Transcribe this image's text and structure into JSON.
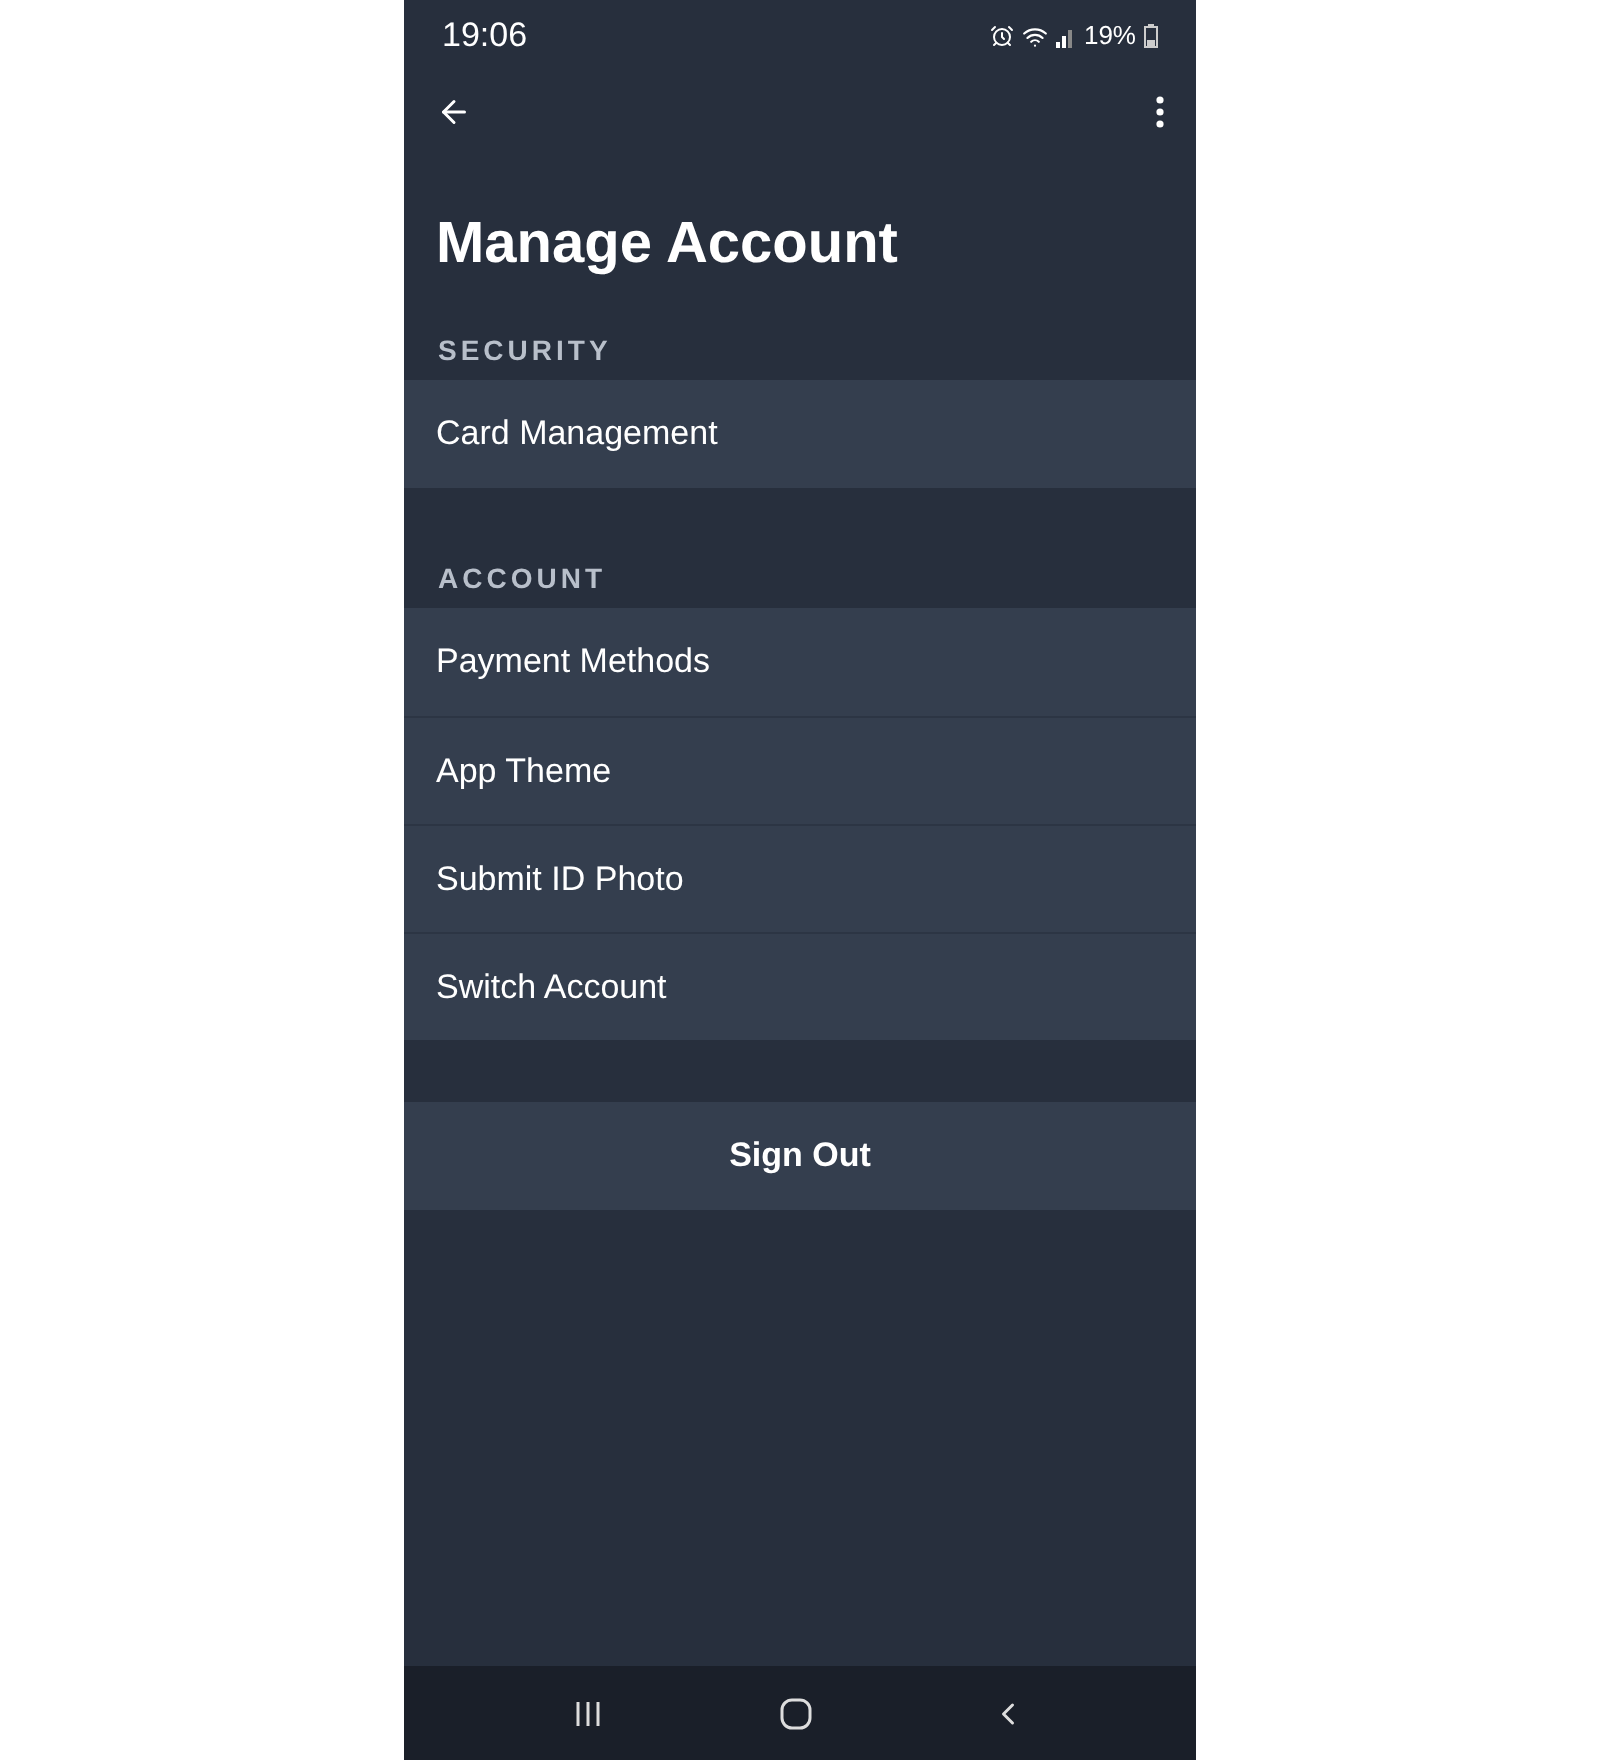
{
  "status_bar": {
    "time": "19:06",
    "battery": "19%"
  },
  "title": "Manage Account",
  "sections": [
    {
      "header": "SECURITY",
      "items": [
        "Card Management"
      ]
    },
    {
      "header": "ACCOUNT",
      "items": [
        "Payment Methods",
        "App Theme",
        "Submit ID Photo",
        "Switch Account"
      ]
    }
  ],
  "sign_out": "Sign Out"
}
